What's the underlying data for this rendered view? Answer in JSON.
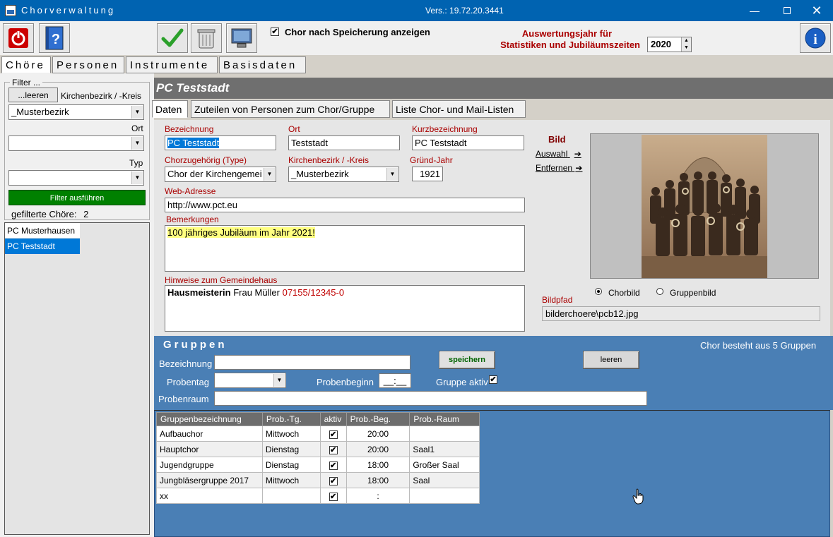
{
  "window": {
    "title": "Chorverwaltung",
    "version": "Vers.: 19.72.20.3441"
  },
  "toolbar": {
    "show_after_save_label": "Chor nach Speicherung anzeigen",
    "show_after_save_checked": "✔",
    "auswertung_line1": "Auswertungsjahr für",
    "auswertung_line2": "Statistiken und Jubiläumszeiten",
    "year": "2020"
  },
  "main_tabs": [
    "Chöre",
    "Personen",
    "Instrumente",
    "Basisdaten"
  ],
  "filter": {
    "group_label": "Filter ...",
    "clear_button": "...leeren",
    "kirchenbezirk_label": "Kirchenbezirk / -Kreis",
    "kirchenbezirk_value": "_Musterbezirk",
    "ort_label": "Ort",
    "ort_value": "",
    "typ_label": "Typ",
    "typ_value": "",
    "run_button": "Filter ausführen",
    "count_label": "gefilterte Chöre:",
    "count": "2",
    "list": [
      "PC Musterhausen",
      "PC Teststadt"
    ]
  },
  "header": {
    "title": "PC Teststadt"
  },
  "sub_tabs": [
    "Daten",
    "Zuteilen von Personen zum Chor/Gruppe",
    "Liste Chor- und Mail-Listen"
  ],
  "daten": {
    "bezeichnung_label": "Bezeichnung",
    "bezeichnung": "PC Teststadt",
    "ort_label": "Ort",
    "ort": "Teststadt",
    "kurz_label": "Kurzbezeichnung",
    "kurz": "PC Teststadt",
    "type_label": "Chorzugehörig (Type)",
    "type": "Chor der Kirchengemei",
    "kb_label": "Kirchenbezirk / -Kreis",
    "kb": "_Musterbezirk",
    "jahr_label": "Gründ-Jahr",
    "jahr": "1921",
    "web_label": "Web-Adresse",
    "web": "http://www.pct.eu",
    "bem_label": "Bemerkungen",
    "bem": "100 jähriges Jubiläum im Jahr 2021!",
    "hinweis_label": "Hinweise zum Gemeindehaus",
    "hinweis_bold": "Hausmeisterin",
    "hinweis_name": "Frau Müller",
    "hinweis_phone": "07155/12345-0",
    "bild_label": "Bild",
    "auswahl": "Auswahl",
    "entfernen": "Entfernen",
    "chorbild": "Chorbild",
    "gruppenbild": "Gruppenbild",
    "bildpfad_label": "Bildpfad",
    "bildpfad": "bilderchoere\\pcb12.jpg"
  },
  "gruppen": {
    "title": "Gruppen",
    "info": "Chor besteht aus 5 Gruppen",
    "bez_label": "Bezeichnung",
    "probentag_label": "Probentag",
    "probenbeginn_label": "Probenbeginn",
    "probenbeginn_value": "__:__",
    "aktiv_label": "Gruppe aktiv",
    "aktiv_checked": "✔",
    "probenraum_label": "Probenraum",
    "save_button": "speichern",
    "clear_button": "leeren",
    "columns": [
      "Gruppenbezeichnung",
      "Prob.-Tg.",
      "aktiv",
      "Prob.-Beg.",
      "Prob.-Raum"
    ],
    "rows": [
      {
        "name": "Aufbauchor",
        "tag": "Mittwoch",
        "aktiv": "✔",
        "beginn": "20:00",
        "raum": ""
      },
      {
        "name": "Hauptchor",
        "tag": "Dienstag",
        "aktiv": "✔",
        "beginn": "20:00",
        "raum": "Saal1"
      },
      {
        "name": "Jugendgruppe",
        "tag": "Dienstag",
        "aktiv": "✔",
        "beginn": "18:00",
        "raum": "Großer Saal"
      },
      {
        "name": "Jungbläsergruppe 2017",
        "tag": "Mittwoch",
        "aktiv": "✔",
        "beginn": "18:00",
        "raum": "Saal"
      },
      {
        "name": "xx",
        "tag": "",
        "aktiv": "✔",
        "beginn": ":",
        "raum": ""
      }
    ]
  },
  "colors": {
    "accent_blue": "#0063b1",
    "group_blue": "#4a7fb5",
    "label_red": "#a00000",
    "run_green": "#008000"
  }
}
